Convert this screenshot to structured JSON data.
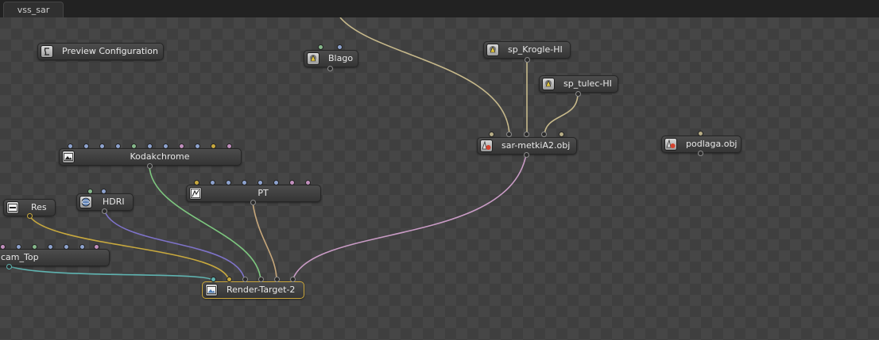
{
  "tab": {
    "title": "vss_sar"
  },
  "colors": {
    "wire_tan": "#c7b98b",
    "wire_green": "#7dc77f",
    "wire_pink": "#c99bc5",
    "wire_purple": "#7e73c9",
    "wire_yellow": "#c8a93e",
    "wire_teal": "#5fb3b0",
    "pin_blue": "#8ea3cf",
    "pin_green": "#86b88b",
    "pin_yellow": "#c8a93e",
    "pin_pink": "#c28fbe",
    "pin_tan": "#b7ad86",
    "selected_border": "#c9a53a"
  },
  "nodes": {
    "preview": {
      "label": "Preview Configuration",
      "icon": "script-icon"
    },
    "blago": {
      "label": "Blago",
      "icon": "light-icon"
    },
    "sp_krogle": {
      "label": "sp_Krogle-HI",
      "icon": "light-icon"
    },
    "sp_tulec": {
      "label": "sp_tulec-HI",
      "icon": "light-icon"
    },
    "sar_metki": {
      "label": "sar-metkiA2.obj",
      "icon": "mesh-icon"
    },
    "podlaga": {
      "label": "podlaga.obj",
      "icon": "mesh-icon"
    },
    "kodakchrome": {
      "label": "Kodakchrome",
      "icon": "image-icon"
    },
    "res": {
      "label": "Res",
      "icon": "resolution-icon"
    },
    "hdri": {
      "label": "HDRI",
      "icon": "environment-icon"
    },
    "pt": {
      "label": "PT",
      "icon": "kernel-icon"
    },
    "cam_top": {
      "label": "cam_Top",
      "icon": "camera-icon"
    },
    "render_target": {
      "label": "Render-Target-2",
      "icon": "render-target-icon"
    }
  }
}
